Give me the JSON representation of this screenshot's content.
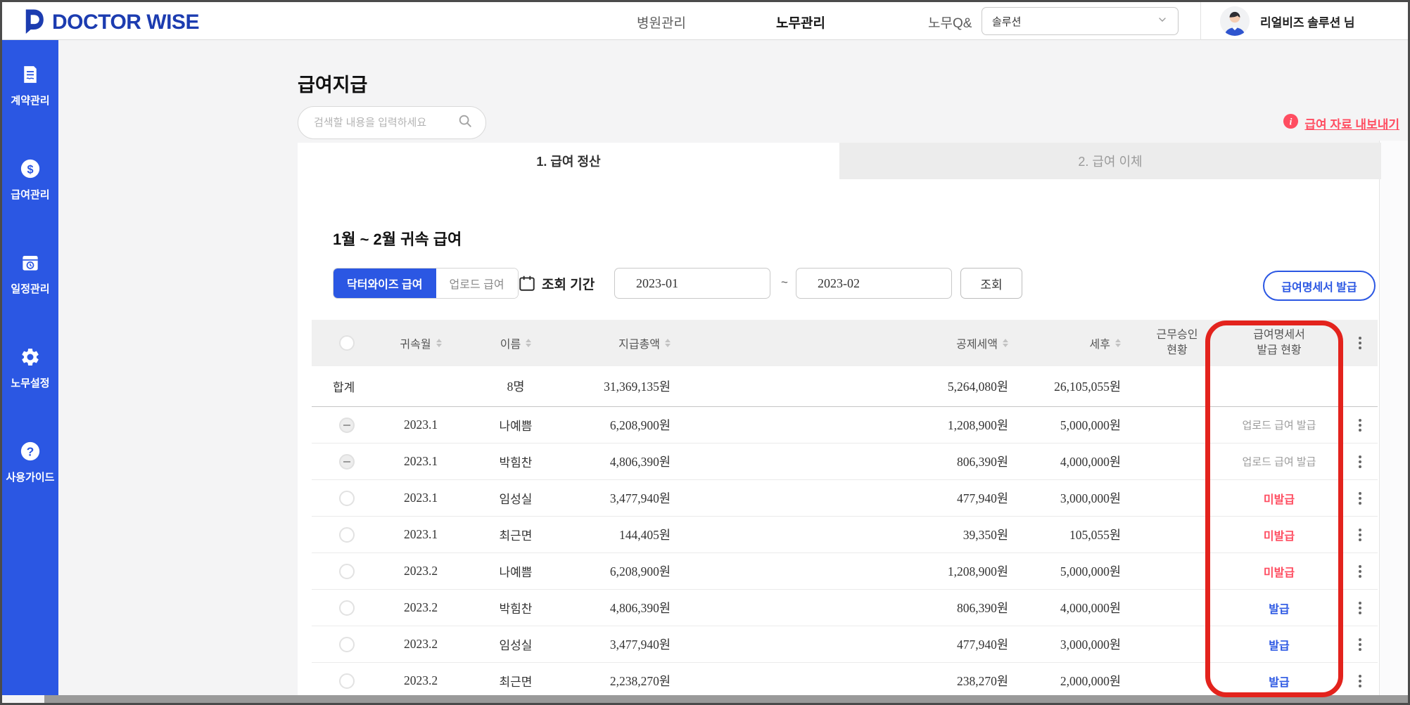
{
  "header": {
    "brand": "DOCTOR WISE",
    "nav": [
      {
        "label": "병원관리",
        "active": false
      },
      {
        "label": "노무관리",
        "active": true
      },
      {
        "label": "노무Q&",
        "active": false
      }
    ],
    "solution_select_value": "솔루션",
    "user_name": "리얼비즈 솔루션 님"
  },
  "sidebar": {
    "items": [
      {
        "label": "계약관리",
        "icon": "contract-document-icon"
      },
      {
        "label": "급여관리",
        "icon": "dollar-circle-icon"
      },
      {
        "label": "일정관리",
        "icon": "schedule-calendar-icon"
      },
      {
        "label": "노무설정",
        "icon": "gear-icon"
      },
      {
        "label": "사용가이드",
        "icon": "question-circle-icon"
      }
    ]
  },
  "page": {
    "title": "급여지급",
    "search_placeholder": "검색할 내용을 입력하세요",
    "export_link": "급여 자료 내보내기",
    "tabs": [
      {
        "label": "1. 급여 정산",
        "active": true
      },
      {
        "label": "2. 급여 이체",
        "active": false
      }
    ],
    "section_title": "1월 ~ 2월 귀속 급여",
    "filters": {
      "toggle": [
        {
          "label": "닥터와이즈 급여",
          "active": true
        },
        {
          "label": "업로드 급여",
          "active": false
        }
      ],
      "period_label": "조회 기간",
      "date_from": "2023-01",
      "date_separator": "~",
      "date_to": "2023-02",
      "search_button": "조회",
      "issue_button": "급여명세서 발급"
    }
  },
  "table": {
    "columns": {
      "month": "귀속월",
      "name": "이름",
      "total": "지급총액",
      "deduction": "공제세액",
      "net": "세후",
      "approval_l1": "근무승인",
      "approval_l2": "현황",
      "payslip_l1": "급여명세서",
      "payslip_l2": "발급 현황"
    },
    "summary": {
      "label": "합계",
      "count": "8명",
      "total": "31,369,135원",
      "deduction": "5,264,080원",
      "net": "26,105,055원"
    },
    "rows": [
      {
        "month": "2023.1",
        "name": "나예쁨",
        "total": "6,208,900원",
        "deduction": "1,208,900원",
        "net": "5,000,000원",
        "status": "업로드 급여 발급",
        "status_type": "uploaded",
        "radio_state": "disabled"
      },
      {
        "month": "2023.1",
        "name": "박힘찬",
        "total": "4,806,390원",
        "deduction": "806,390원",
        "net": "4,000,000원",
        "status": "업로드 급여 발급",
        "status_type": "uploaded",
        "radio_state": "disabled"
      },
      {
        "month": "2023.1",
        "name": "임성실",
        "total": "3,477,940원",
        "deduction": "477,940원",
        "net": "3,000,000원",
        "status": "미발급",
        "status_type": "not_issued",
        "radio_state": "enabled"
      },
      {
        "month": "2023.1",
        "name": "최근면",
        "total": "144,405원",
        "deduction": "39,350원",
        "net": "105,055원",
        "status": "미발급",
        "status_type": "not_issued",
        "radio_state": "enabled"
      },
      {
        "month": "2023.2",
        "name": "나예쁨",
        "total": "6,208,900원",
        "deduction": "1,208,900원",
        "net": "5,000,000원",
        "status": "미발급",
        "status_type": "not_issued",
        "radio_state": "enabled"
      },
      {
        "month": "2023.2",
        "name": "박힘찬",
        "total": "4,806,390원",
        "deduction": "806,390원",
        "net": "4,000,000원",
        "status": "발급",
        "status_type": "issued",
        "radio_state": "enabled"
      },
      {
        "month": "2023.2",
        "name": "임성실",
        "total": "3,477,940원",
        "deduction": "477,940원",
        "net": "3,000,000원",
        "status": "발급",
        "status_type": "issued",
        "radio_state": "enabled"
      },
      {
        "month": "2023.2",
        "name": "최근면",
        "total": "2,238,270원",
        "deduction": "238,270원",
        "net": "2,000,000원",
        "status": "발급",
        "status_type": "issued",
        "radio_state": "enabled"
      }
    ]
  },
  "colors": {
    "accent_blue": "#2b57e3",
    "logo_navy": "#1c3cb0",
    "alert_red": "#ff4d61",
    "annotation_red": "#e3231d",
    "header_gray": "#f0f0f0",
    "page_bg": "#f4f4f5"
  }
}
